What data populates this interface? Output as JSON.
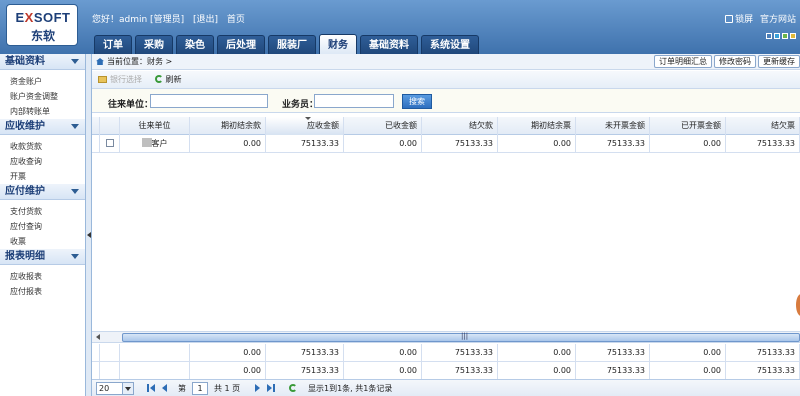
{
  "header": {
    "logo_top_left": "E",
    "logo_top_x": "X",
    "logo_top_right": "SOFT",
    "logo_bottom": "东软",
    "greeting": "您好！admin [管理员]",
    "logout": "[退出]",
    "home": "首页",
    "lock": "锁屏",
    "official_site": "官方网站"
  },
  "nav": {
    "tabs": [
      {
        "label": "订单"
      },
      {
        "label": "采购"
      },
      {
        "label": "染色"
      },
      {
        "label": "后处理"
      },
      {
        "label": "服装厂"
      },
      {
        "label": "财务"
      },
      {
        "label": "基础资料"
      },
      {
        "label": "系统设置"
      }
    ]
  },
  "theme_colors": [
    "#4c7fb8",
    "#39a0d8",
    "#6bb54a",
    "#e0b93a"
  ],
  "sidebar": {
    "groups": [
      {
        "title": "基础资料",
        "items": [
          "资金账户",
          "账户资金调整",
          "内部转账单"
        ]
      },
      {
        "title": "应收维护",
        "items": [
          "收款货款",
          "应收查询",
          "开票"
        ]
      },
      {
        "title": "应付维护",
        "items": [
          "支付货款",
          "应付查询",
          "收票"
        ]
      },
      {
        "title": "报表明细",
        "items": [
          "应收报表",
          "应付报表"
        ]
      }
    ]
  },
  "crumb": {
    "location": "当前位置：财务 >",
    "btn_order_summary": "订单明细汇总",
    "btn_change_pwd": "修改密码",
    "btn_update_cache": "更新缓存"
  },
  "toolbar": {
    "disabled_label": "银行选择",
    "refresh": "刷新"
  },
  "search": {
    "partner_label": "往来单位：",
    "salesman_label": "业务员：",
    "button": "搜索"
  },
  "grid": {
    "columns": [
      "往来单位",
      "期初结余款",
      "应收金额",
      "已收金额",
      "结欠款",
      "期初结余票",
      "未开票金额",
      "已开票金额",
      "结欠票"
    ],
    "rows": [
      {
        "partner": "客户",
        "v": [
          "0.00",
          "75133.33",
          "0.00",
          "75133.33",
          "0.00",
          "75133.33",
          "0.00",
          "75133.33"
        ]
      }
    ],
    "footer_rows": [
      [
        "0.00",
        "75133.33",
        "0.00",
        "75133.33",
        "0.00",
        "75133.33",
        "0.00",
        "75133.33"
      ],
      [
        "0.00",
        "75133.33",
        "0.00",
        "75133.33",
        "0.00",
        "75133.33",
        "0.00",
        "75133.33"
      ]
    ]
  },
  "scroll_thumb_glyph": "|||",
  "pager": {
    "page_size": "20",
    "page_label": "第",
    "page_value": "1",
    "total_pages": "共 1 页",
    "summary": "显示1到1条, 共1条记录"
  }
}
